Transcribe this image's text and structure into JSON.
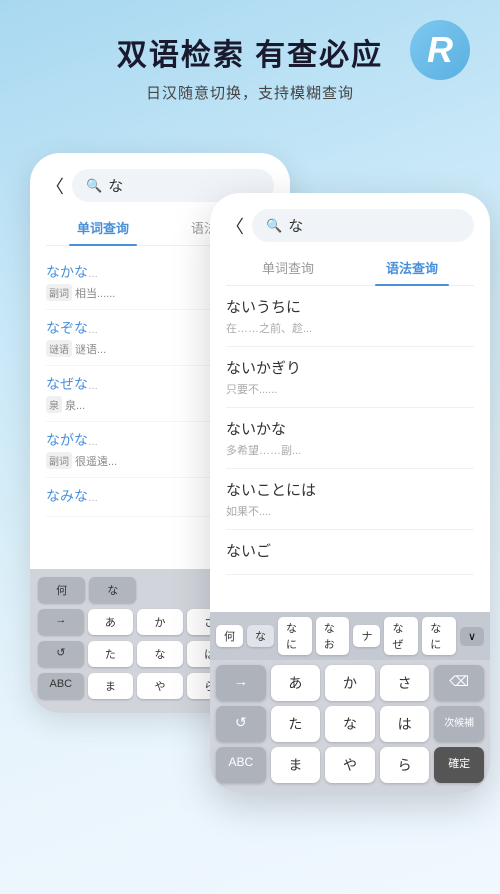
{
  "app": {
    "main_title": "双语检索 有查必应",
    "sub_title": "日汉随意切换，支持模糊查询",
    "logo_letter": "R"
  },
  "phone_back": {
    "search_icon": "🔍",
    "search_text": "な",
    "tab_word": "单词查询",
    "tab_grammar": "语法查询",
    "results": [
      {
        "jp": "なかな",
        "tag": "副词",
        "cn": "相当......"
      },
      {
        "jp": "なぞな",
        "tag": "谜语",
        "cn": "谜语..."
      },
      {
        "jp": "なぜな",
        "tag": "泉",
        "cn": "泉..."
      },
      {
        "jp": "ながな",
        "tag": "副词",
        "cn": "很遥遠..."
      },
      {
        "jp": "なみな",
        "cn": ""
      }
    ],
    "kb_row1": [
      "何",
      "な"
    ],
    "kb_row2": [
      "→"
    ],
    "kb_row3": [
      "↺"
    ],
    "kb_row4": [
      "ABC"
    ]
  },
  "phone_front": {
    "back_text": "〈",
    "search_icon": "🔍",
    "search_text": "な",
    "tab_word": "单词查询",
    "tab_grammar": "语法查询",
    "grammar_items": [
      {
        "jp": "ないうちに",
        "cn": "在……之前、趁..."
      },
      {
        "jp": "ないかぎり",
        "cn": "只要不......"
      },
      {
        "jp": "ないかな",
        "cn": "多希望……副..."
      },
      {
        "jp": "ないことには",
        "cn": "如果不...."
      },
      {
        "jp": "ないご",
        "cn": ""
      }
    ],
    "kb_topbar_items": [
      "何",
      "な",
      "なに",
      "なお",
      "ナ",
      "なぜ",
      "なに"
    ],
    "kb_topbar_arrow": "∨",
    "kb_rows": [
      [
        "→",
        "あ",
        "か",
        "さ",
        "⌫"
      ],
      [
        "↺",
        "た",
        "な",
        "は",
        "次候補"
      ],
      [
        "ABC",
        "ま",
        "や",
        "ら",
        "確定"
      ]
    ]
  }
}
